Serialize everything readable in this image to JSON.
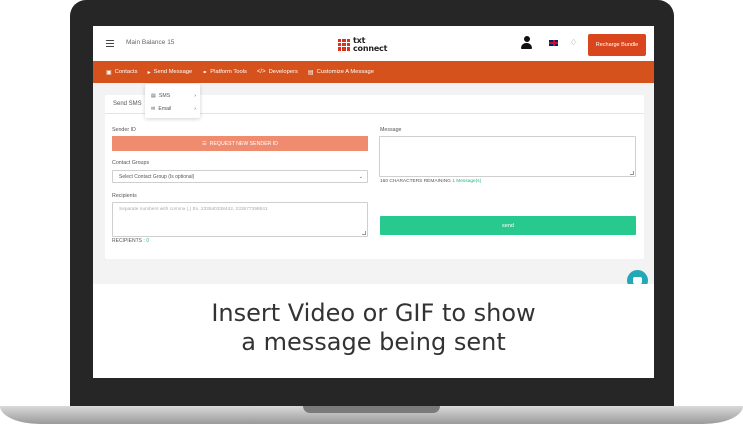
{
  "topbar": {
    "main_balance": "Main Balance 15",
    "logo_line1": "txt",
    "logo_line2": "connect",
    "recharge_label": "Recharge Bundle"
  },
  "nav": {
    "items": [
      {
        "label": "Contacts",
        "icon": "contact-book-icon"
      },
      {
        "label": "Send Message",
        "icon": "megaphone-icon"
      },
      {
        "label": "Platform Tools",
        "icon": "plug-icon"
      },
      {
        "label": "Developers",
        "icon": "code-icon"
      },
      {
        "label": "Customize A Message",
        "icon": "layout-icon"
      }
    ]
  },
  "dropdown": {
    "items": [
      {
        "label": "SMS",
        "icon": "sms-icon"
      },
      {
        "label": "Email",
        "icon": "envelope-icon"
      }
    ]
  },
  "form": {
    "title": "Send SMS",
    "sender_id_label": "Sender ID",
    "request_sender_id_label": "REQUEST NEW SENDER ID",
    "contact_groups_label": "Contact Groups",
    "contact_groups_selected": "Select Contact Group (Is optional)",
    "recipients_label": "Recipients",
    "recipients_placeholder": "Separate numbers with comma (,) Ex. 233540338442, 233577398841",
    "recipients_count_label": "RECIPIENTS :",
    "recipients_count": "0",
    "message_label": "Message",
    "chars_remaining_text": "160 CHARACTERS REMAINING",
    "messages_count_text": "1 Message(s)",
    "send_label": "send"
  },
  "overlay": {
    "line1": "Insert Video or GIF to show",
    "line2": "a message being sent"
  },
  "colors": {
    "brand_orange": "#d5521c",
    "request_button": "#ef8c70",
    "send_button": "#27c98f",
    "chat_fab": "#23a8b8"
  }
}
